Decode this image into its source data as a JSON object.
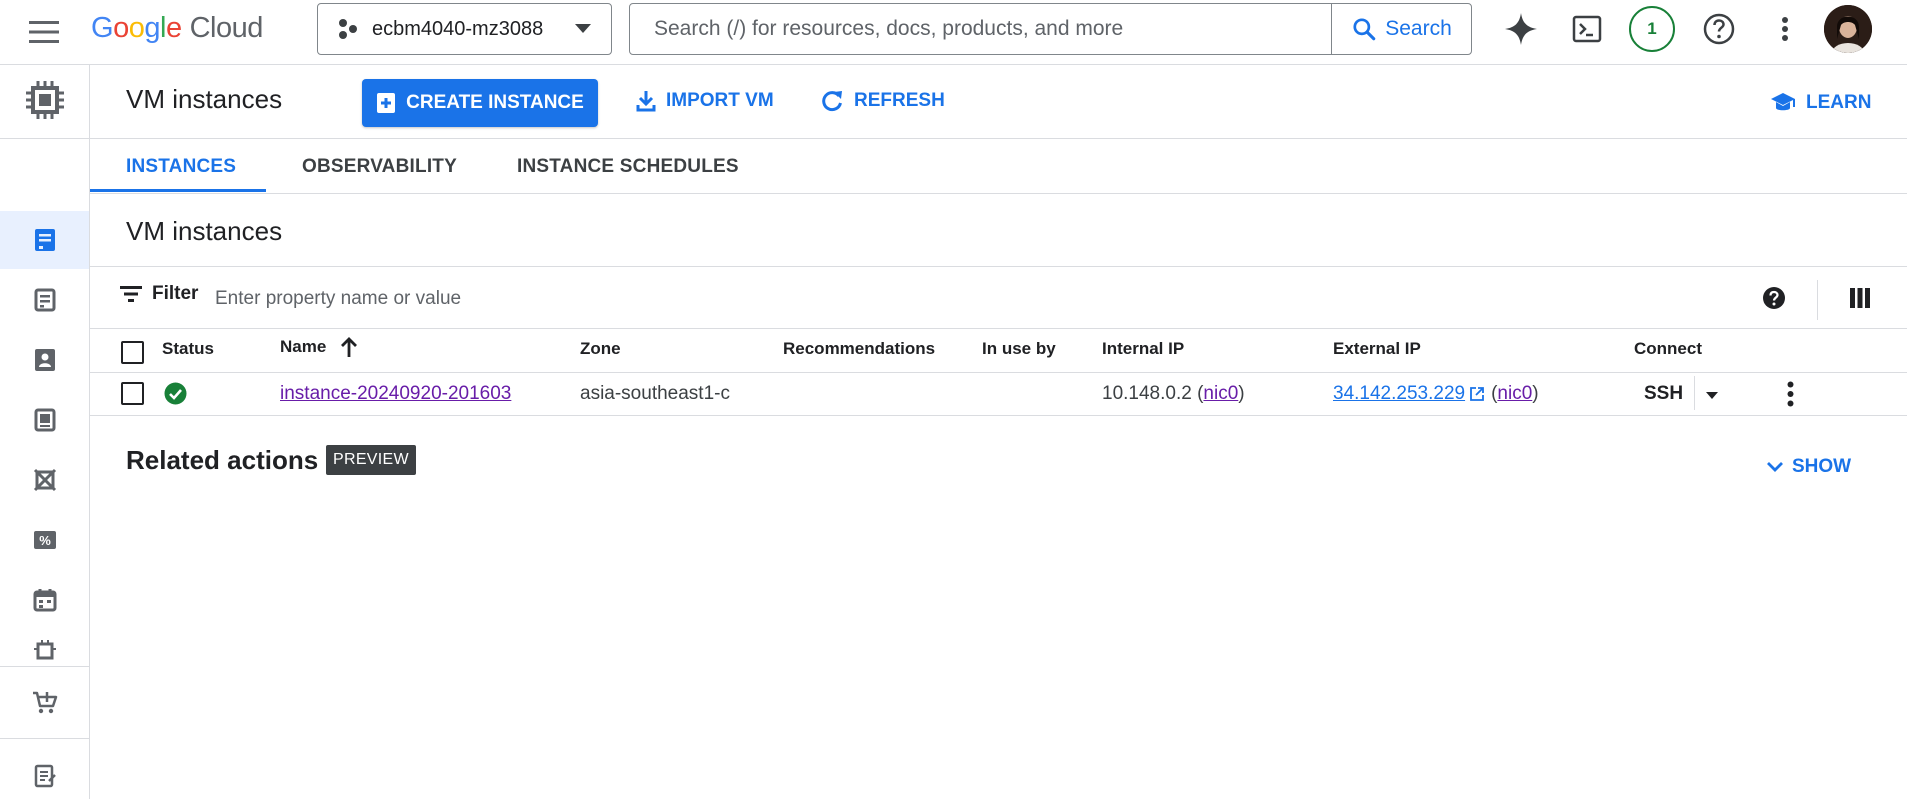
{
  "topbar": {
    "logo_google": "Google",
    "logo_cloud": "Cloud",
    "project_name": "ecbm4040-mz3088",
    "search_placeholder": "Search (/) for resources, docs, products, and more",
    "search_button": "Search",
    "notification_count": "1"
  },
  "header": {
    "title": "VM instances",
    "create_button": "CREATE INSTANCE",
    "import_button": "IMPORT VM",
    "refresh_button": "REFRESH",
    "learn_button": "LEARN"
  },
  "tabs": [
    {
      "label": "INSTANCES",
      "active": true
    },
    {
      "label": "OBSERVABILITY",
      "active": false
    },
    {
      "label": "INSTANCE SCHEDULES",
      "active": false
    }
  ],
  "section": {
    "title": "VM instances"
  },
  "filter": {
    "label": "Filter",
    "placeholder": "Enter property name or value"
  },
  "table": {
    "columns": [
      "Status",
      "Name",
      "Zone",
      "Recommendations",
      "In use by",
      "Internal IP",
      "External IP",
      "Connect"
    ],
    "rows": [
      {
        "status": "running",
        "name": "instance-20240920-201603",
        "zone": "asia-southeast1-c",
        "recommendations": "",
        "in_use_by": "",
        "internal_ip": "10.148.0.2",
        "internal_nic": "nic0",
        "external_ip": "34.142.253.229",
        "external_nic": "nic0",
        "connect": "SSH"
      }
    ]
  },
  "related": {
    "title": "Related actions",
    "badge": "PREVIEW",
    "show_button": "SHOW"
  },
  "colors": {
    "accent": "#1a73e8",
    "success": "#188038",
    "visited_link": "#681da8"
  }
}
